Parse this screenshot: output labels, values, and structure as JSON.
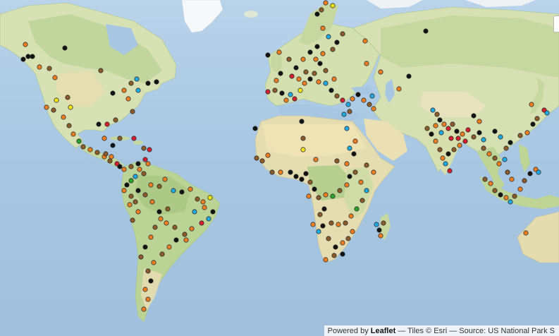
{
  "map": {
    "basemap": "Esri World Physical",
    "attribution": {
      "prefix": "Powered by",
      "leaflet": "Leaflet",
      "rest": "— Tiles © Esri — Source: US National Park S"
    },
    "colors": {
      "ocean": "#a9c9e4",
      "land": "#dde5b8",
      "forest": "#b9d194",
      "desert": "#ebdfb4",
      "ice": "#f7f9fb",
      "marker_stroke": "#333333"
    },
    "marker_palette": [
      "#ef7d22",
      "#8a5a2b",
      "#111111",
      "#20a9e1",
      "#d11f2f",
      "#f3e416",
      "#29a329",
      "#a0a0a0",
      "#c070c0"
    ],
    "note": "Markers are circle points on the map; positions are in the script."
  }
}
